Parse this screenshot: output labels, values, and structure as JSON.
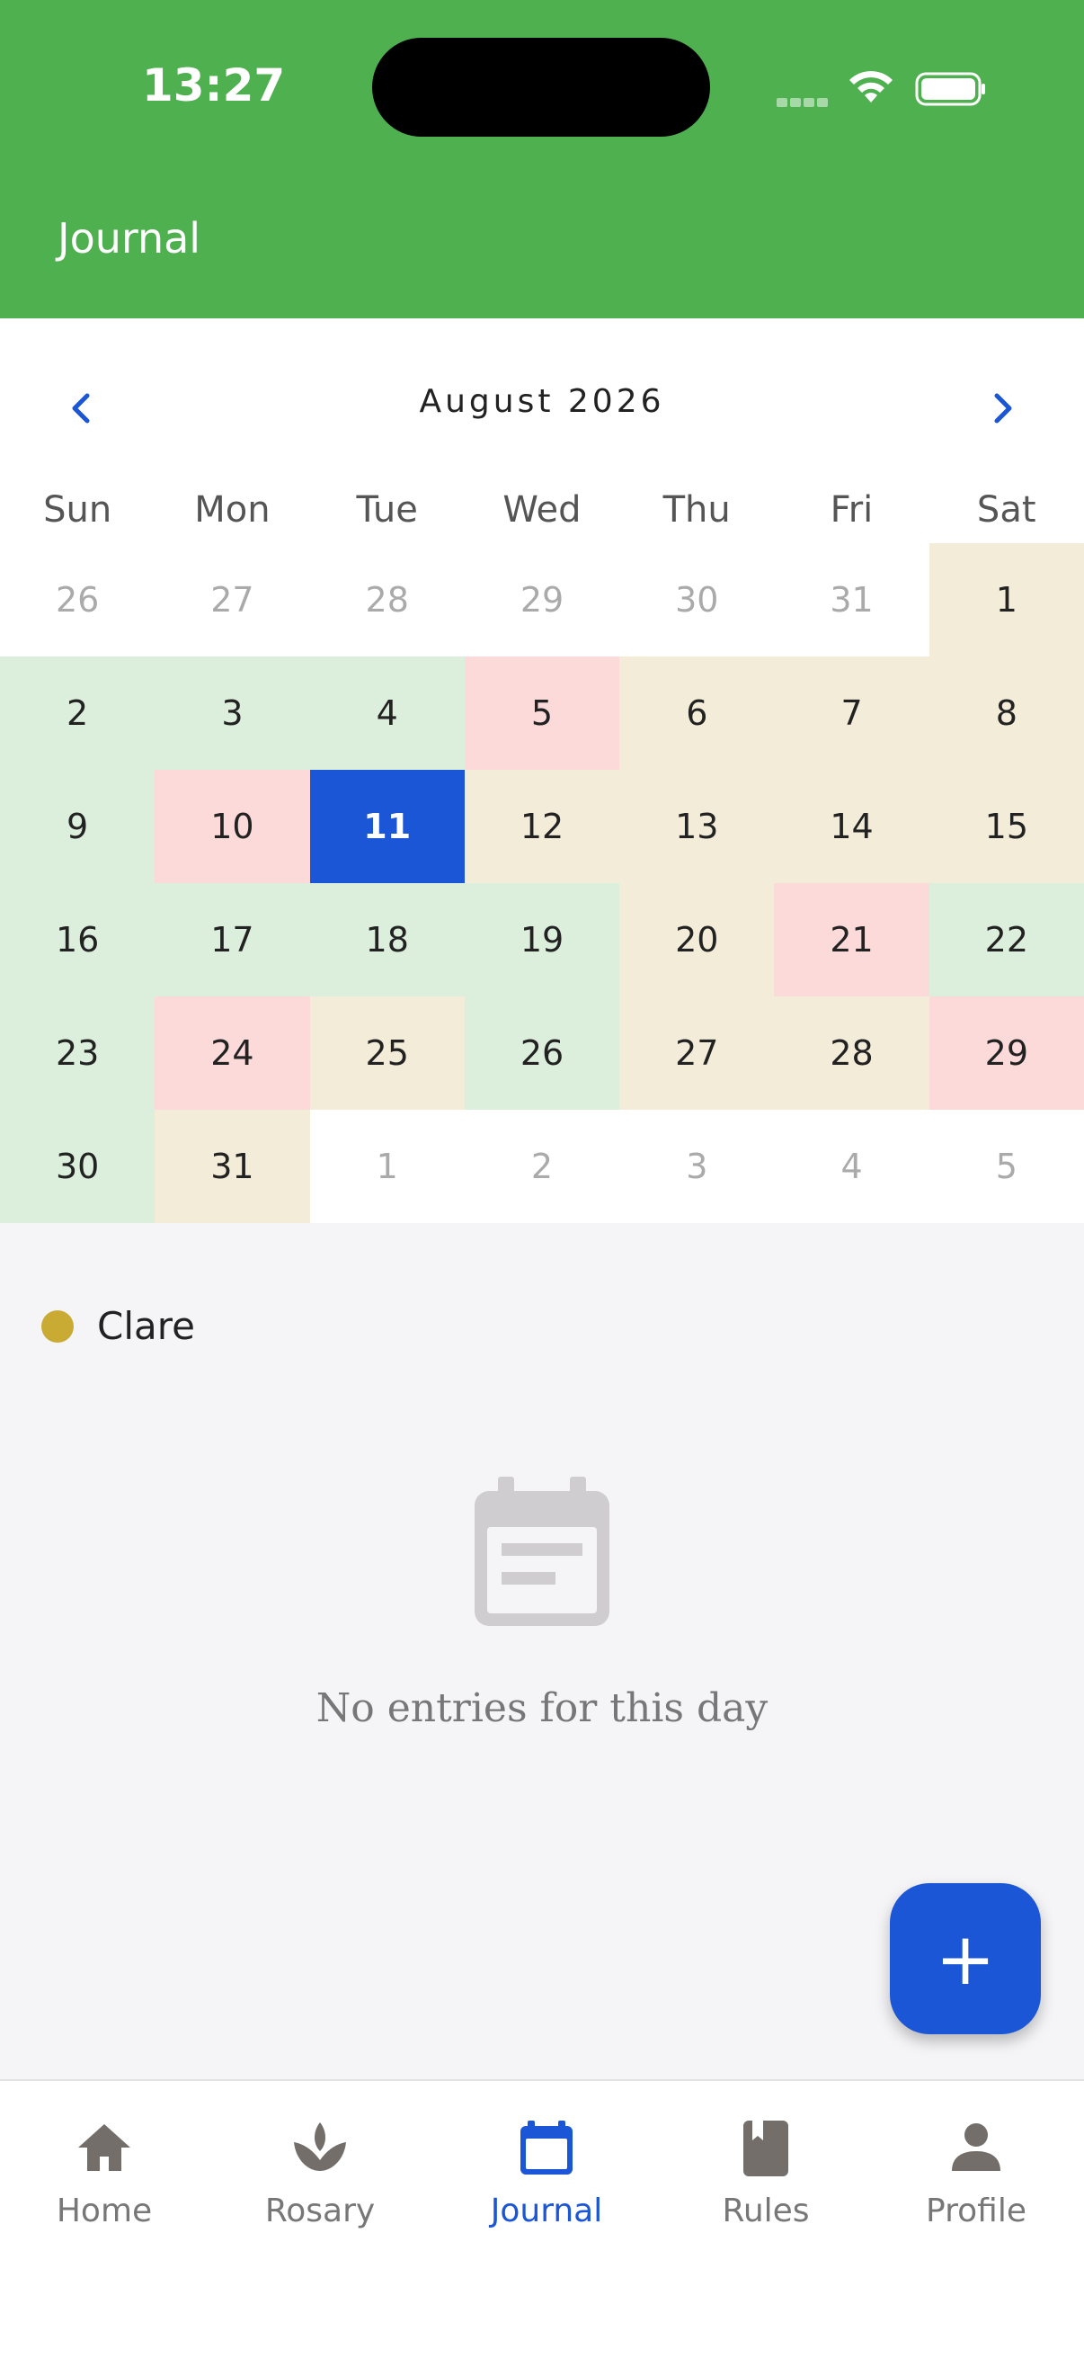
{
  "status_bar": {
    "time": "13:27"
  },
  "header": {
    "title": "Journal"
  },
  "calendar": {
    "month_label": "August 2026",
    "weekdays": [
      "Sun",
      "Mon",
      "Tue",
      "Wed",
      "Thu",
      "Fri",
      "Sat"
    ],
    "days": [
      {
        "label": "26",
        "outside": true,
        "status": "none"
      },
      {
        "label": "27",
        "outside": true,
        "status": "none"
      },
      {
        "label": "28",
        "outside": true,
        "status": "none"
      },
      {
        "label": "29",
        "outside": true,
        "status": "none"
      },
      {
        "label": "30",
        "outside": true,
        "status": "none"
      },
      {
        "label": "31",
        "outside": true,
        "status": "none"
      },
      {
        "label": "1",
        "outside": false,
        "status": "beige"
      },
      {
        "label": "2",
        "outside": false,
        "status": "green"
      },
      {
        "label": "3",
        "outside": false,
        "status": "green"
      },
      {
        "label": "4",
        "outside": false,
        "status": "green"
      },
      {
        "label": "5",
        "outside": false,
        "status": "pink"
      },
      {
        "label": "6",
        "outside": false,
        "status": "beige"
      },
      {
        "label": "7",
        "outside": false,
        "status": "beige"
      },
      {
        "label": "8",
        "outside": false,
        "status": "beige"
      },
      {
        "label": "9",
        "outside": false,
        "status": "green"
      },
      {
        "label": "10",
        "outside": false,
        "status": "pink"
      },
      {
        "label": "11",
        "outside": false,
        "status": "selected"
      },
      {
        "label": "12",
        "outside": false,
        "status": "beige"
      },
      {
        "label": "13",
        "outside": false,
        "status": "beige"
      },
      {
        "label": "14",
        "outside": false,
        "status": "beige"
      },
      {
        "label": "15",
        "outside": false,
        "status": "beige"
      },
      {
        "label": "16",
        "outside": false,
        "status": "green"
      },
      {
        "label": "17",
        "outside": false,
        "status": "green"
      },
      {
        "label": "18",
        "outside": false,
        "status": "green"
      },
      {
        "label": "19",
        "outside": false,
        "status": "green"
      },
      {
        "label": "20",
        "outside": false,
        "status": "beige"
      },
      {
        "label": "21",
        "outside": false,
        "status": "pink"
      },
      {
        "label": "22",
        "outside": false,
        "status": "green"
      },
      {
        "label": "23",
        "outside": false,
        "status": "green"
      },
      {
        "label": "24",
        "outside": false,
        "status": "pink"
      },
      {
        "label": "25",
        "outside": false,
        "status": "beige"
      },
      {
        "label": "26",
        "outside": false,
        "status": "green"
      },
      {
        "label": "27",
        "outside": false,
        "status": "beige"
      },
      {
        "label": "28",
        "outside": false,
        "status": "beige"
      },
      {
        "label": "29",
        "outside": false,
        "status": "pink"
      },
      {
        "label": "30",
        "outside": false,
        "status": "green"
      },
      {
        "label": "31",
        "outside": false,
        "status": "beige"
      },
      {
        "label": "1",
        "outside": true,
        "status": "none"
      },
      {
        "label": "2",
        "outside": true,
        "status": "none"
      },
      {
        "label": "3",
        "outside": true,
        "status": "none"
      },
      {
        "label": "4",
        "outside": true,
        "status": "none"
      },
      {
        "label": "5",
        "outside": true,
        "status": "none"
      }
    ]
  },
  "person": {
    "name": "Clare",
    "color": "#c9ab33"
  },
  "empty_state": {
    "icon": "calendar-note-icon",
    "message": "No entries for this day"
  },
  "fab": {
    "label": "+"
  },
  "tabbar": {
    "tabs": [
      {
        "label": "Home",
        "icon": "home-icon",
        "active": false
      },
      {
        "label": "Rosary",
        "icon": "lotus-icon",
        "active": false
      },
      {
        "label": "Journal",
        "icon": "calendar-icon",
        "active": true
      },
      {
        "label": "Rules",
        "icon": "book-icon",
        "active": false
      },
      {
        "label": "Profile",
        "icon": "person-icon",
        "active": false
      }
    ]
  },
  "colors": {
    "header": "#4fb04f",
    "accent": "#1a56d6",
    "good_day": "#dcefdc",
    "bad_day": "#fcdada",
    "neutral_day": "#f3ecd8"
  }
}
